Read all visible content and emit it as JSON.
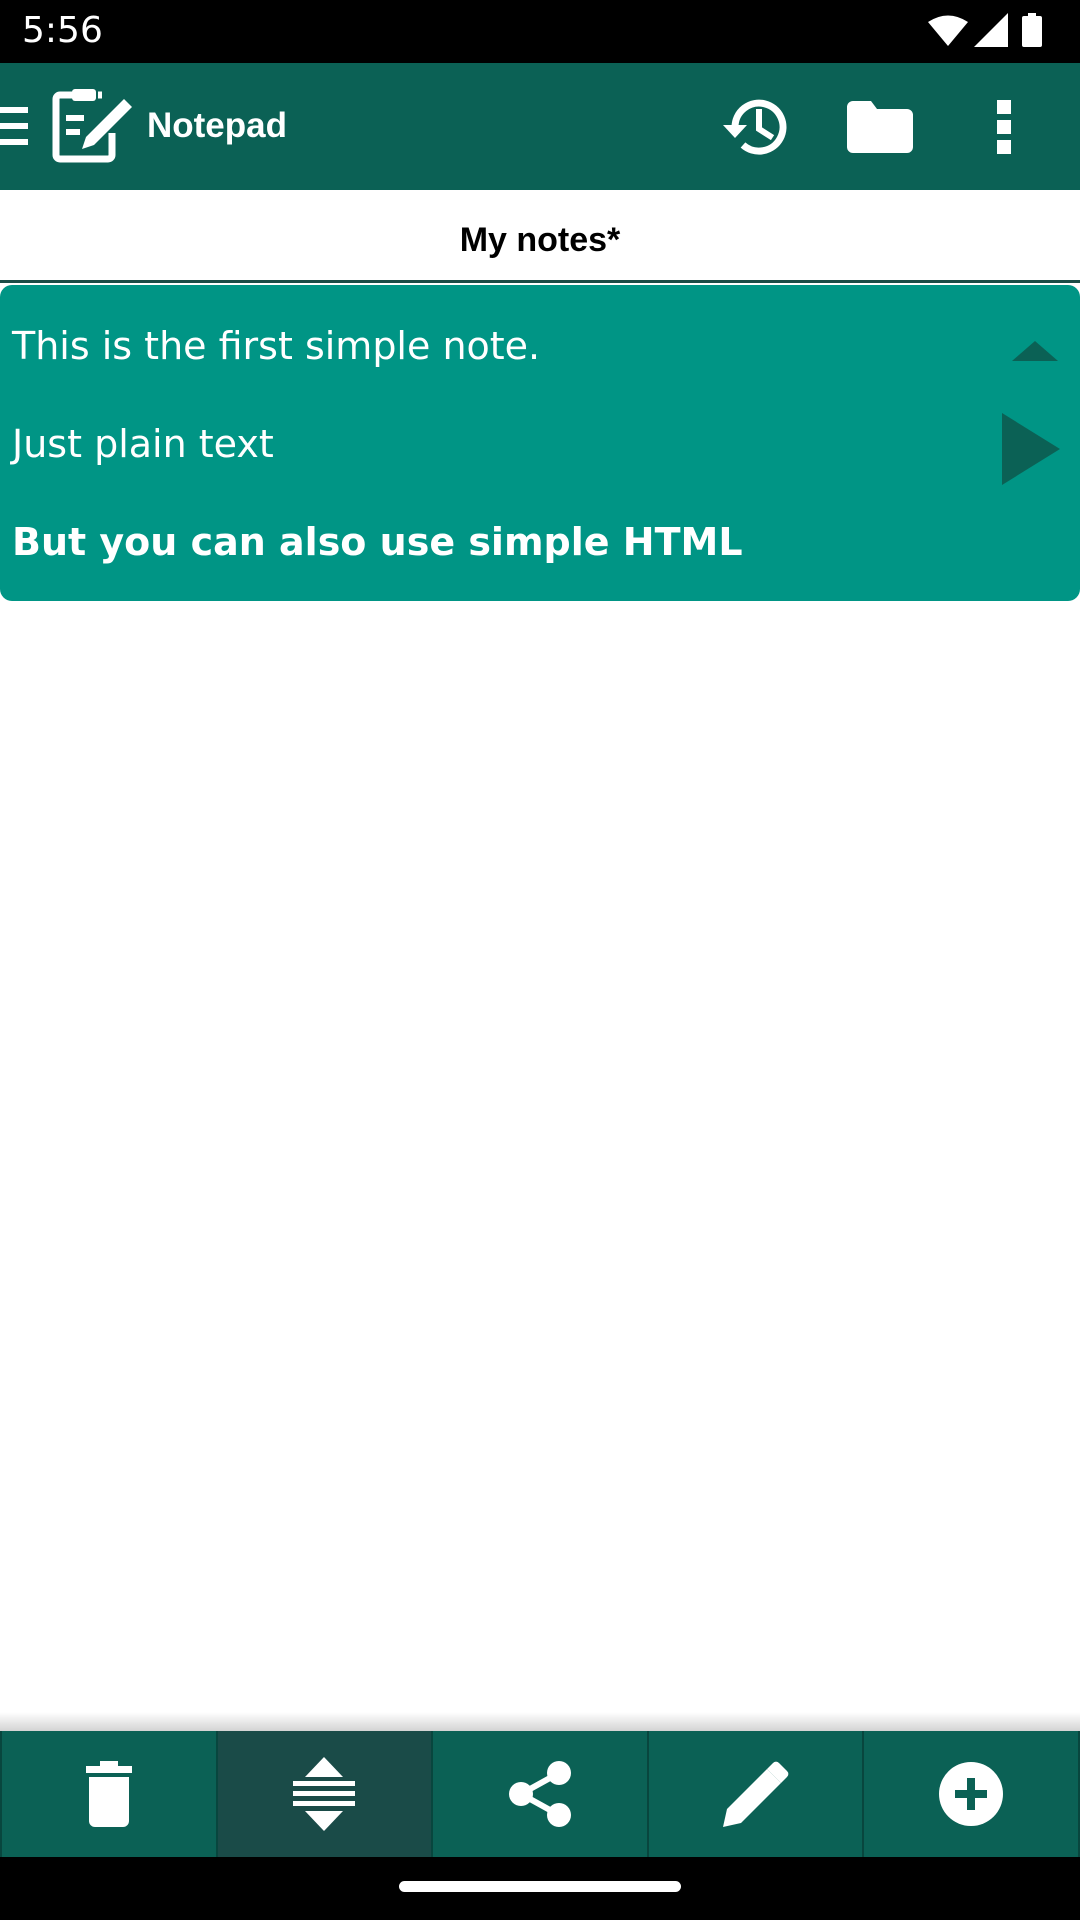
{
  "status_bar": {
    "time": "5:56",
    "icons": [
      "wifi-icon",
      "signal-icon",
      "battery-icon"
    ]
  },
  "app_bar": {
    "title": "Notepad",
    "icons": {
      "menu": "menu-icon",
      "logo": "notepad-edit-icon",
      "history": "history-icon",
      "folder": "folder-icon",
      "overflow": "more-vert-icon"
    }
  },
  "tab": {
    "label": "My notes*"
  },
  "note": {
    "lines": [
      "This is the first simple note.",
      "Just plain text",
      "But you can also use simple HTML"
    ],
    "icons": {
      "collapse": "collapse-up-icon",
      "play": "play-icon"
    }
  },
  "bottom_toolbar": {
    "buttons": [
      {
        "icon": "delete-icon",
        "active": false
      },
      {
        "icon": "expand-collapse-icon",
        "active": true
      },
      {
        "icon": "share-icon",
        "active": false
      },
      {
        "icon": "edit-icon",
        "active": false
      },
      {
        "icon": "add-circle-icon",
        "active": false
      }
    ]
  },
  "colors": {
    "primary": "#0b6155",
    "note_background": "#009585",
    "tab_indicator": "#1c4d47",
    "active_tool": "#1a4b48",
    "status_bar": "#000000"
  }
}
